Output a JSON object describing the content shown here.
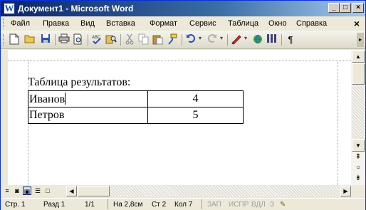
{
  "window": {
    "title": "Документ1 - Microsoft Word",
    "app_icon": "W",
    "controls": {
      "minimize": "_",
      "maximize": "□",
      "close": "×"
    }
  },
  "menu": {
    "items": [
      "Файл",
      "Правка",
      "Вид",
      "Вставка",
      "Формат",
      "Сервис",
      "Таблица",
      "Окно",
      "Справка"
    ],
    "doc_close": "×"
  },
  "toolbar": {
    "icons": [
      "new-document-icon",
      "open-folder-icon",
      "save-icon",
      "print-icon",
      "print-preview-icon",
      "spelling-icon",
      "research-icon",
      "cut-icon",
      "copy-icon",
      "paste-icon",
      "format-painter-icon",
      "undo-icon",
      "redo-icon",
      "drawing-icon",
      "table-icon",
      "columns-icon",
      "show-formatting-icon"
    ],
    "paragraph_mark": "¶"
  },
  "document": {
    "heading": "Таблица результатов:",
    "table": {
      "rows": [
        {
          "name": "Иванов",
          "value": "4"
        },
        {
          "name": "Петров",
          "value": "5"
        }
      ]
    }
  },
  "status": {
    "page": "Стр. 1",
    "section": "Разд 1",
    "page_count": "1/1",
    "position": "На 2,8см",
    "line": "Ст 2",
    "column": "Кол 7",
    "modes": [
      "ЗАП",
      "ИСПР",
      "ВДЛ",
      "З"
    ]
  }
}
